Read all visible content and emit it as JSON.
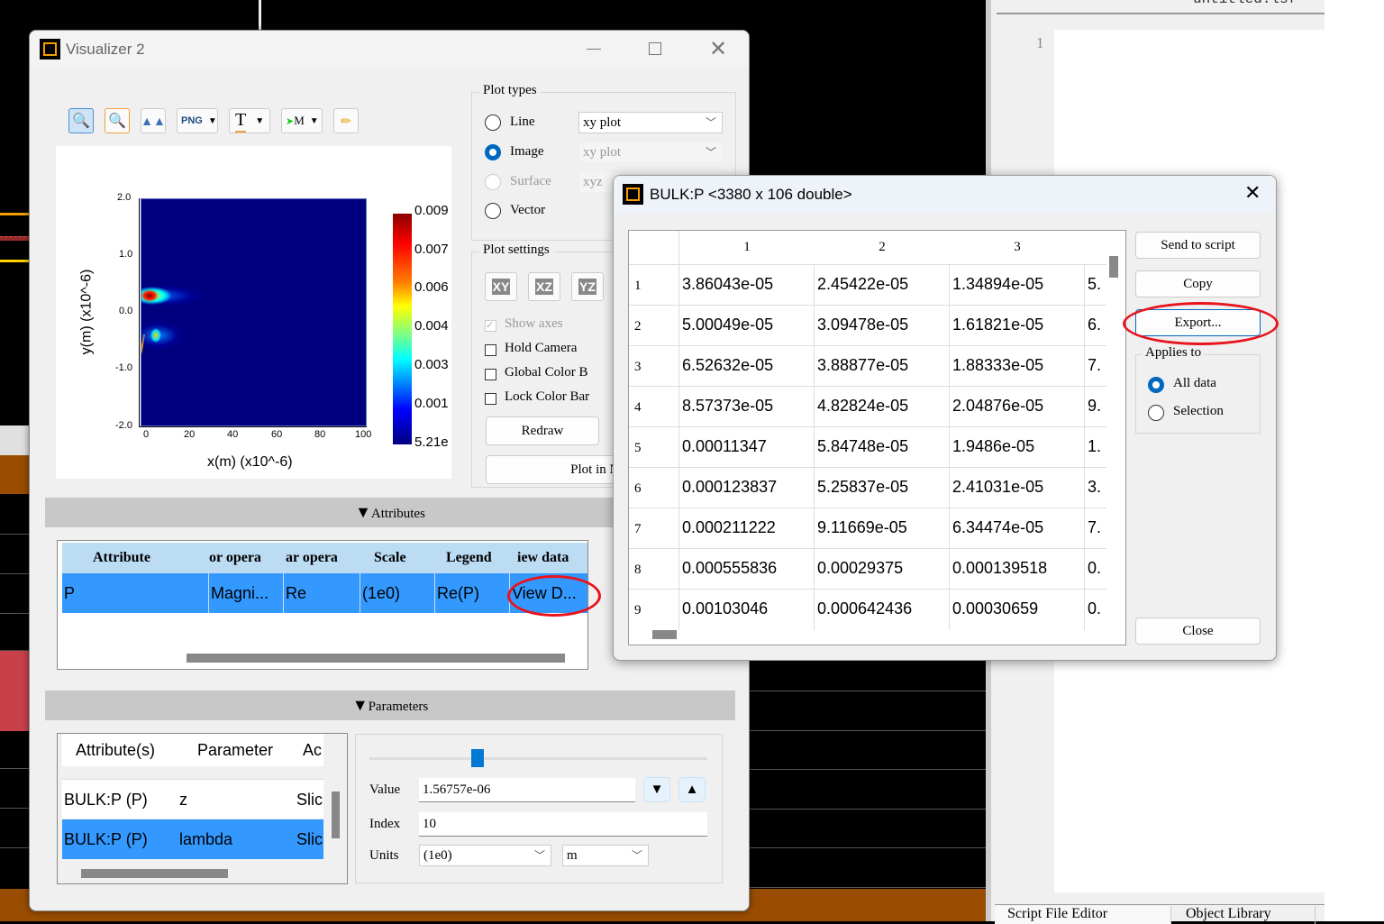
{
  "visualizer": {
    "title": "Visualizer 2",
    "toolbar": [
      {
        "icon": "zoom-reset-icon"
      },
      {
        "icon": "zoom-region-icon"
      },
      {
        "icon": "mountain-view-icon"
      },
      {
        "icon": "png-export-icon",
        "label": "PNG"
      },
      {
        "icon": "text-icon",
        "label": "T"
      },
      {
        "icon": "matlab-export-icon",
        "label": "M"
      },
      {
        "icon": "pencil-icon"
      }
    ],
    "plot": {
      "xlabel": "x(m) (x10^-6)",
      "ylabel": "y(m) (x10^-6)",
      "xticks": [
        "0",
        "20",
        "40",
        "60",
        "80",
        "100"
      ],
      "yticks": [
        "2.0",
        "1.0",
        "0.0",
        "-1.0",
        "-2.0"
      ],
      "colorbar_ticks": [
        "0.009",
        "0.007",
        "0.006",
        "0.004",
        "0.003",
        "0.001",
        "5.21e"
      ]
    },
    "plot_types": {
      "title": "Plot types",
      "options": [
        {
          "label": "Line",
          "selected": false,
          "combo": "xy plot"
        },
        {
          "label": "Image",
          "selected": true,
          "combo": "xy plot"
        },
        {
          "label": "Surface",
          "selected": false,
          "combo": "xyz"
        },
        {
          "label": "Vector",
          "selected": false
        }
      ]
    },
    "plot_settings": {
      "title": "Plot settings",
      "view_buttons": [
        "XY",
        "XZ",
        "YZ"
      ],
      "checks": [
        {
          "label": "Show axes",
          "checked": true,
          "disabled": true
        },
        {
          "label": "Hold Camera",
          "checked": false
        },
        {
          "label": "Global Color B",
          "checked": false
        },
        {
          "label": "Lock Color Bar",
          "checked": false
        }
      ],
      "redraw": "Redraw",
      "plot_new": "Plot in Ne"
    },
    "attributes": {
      "header": "Attributes",
      "columns": [
        "Attribute",
        "or opera",
        "ar opera",
        "Scale",
        "Legend",
        "iew data"
      ],
      "row": [
        "P",
        "Magni...",
        "Re",
        "(1e0)",
        "Re(P)",
        "View D..."
      ]
    },
    "parameters": {
      "header": "Parameters",
      "columns": [
        "Attribute(s)",
        "Parameter",
        "Ac"
      ],
      "rows": [
        [
          "BULK:P (P)",
          "z",
          "Slic"
        ],
        [
          "BULK:P (P)",
          "lambda",
          "Slic"
        ]
      ],
      "value_label": "Value",
      "value": "1.56757e-06",
      "index_label": "Index",
      "index": "10",
      "units_label": "Units",
      "units_scale": "(1e0)",
      "units": "m",
      "slider_fraction": 0.32
    }
  },
  "dialog": {
    "title": "BULK:P <3380 x 106 double>",
    "columns": [
      "1",
      "2",
      "3"
    ],
    "rows": [
      [
        "1",
        "3.86043e-05",
        "2.45422e-05",
        "1.34894e-05",
        "5."
      ],
      [
        "2",
        "5.00049e-05",
        "3.09478e-05",
        "1.61821e-05",
        "6."
      ],
      [
        "3",
        "6.52632e-05",
        "3.88877e-05",
        "1.88333e-05",
        "7."
      ],
      [
        "4",
        "8.57373e-05",
        "4.82824e-05",
        "2.04876e-05",
        "9."
      ],
      [
        "5",
        "0.00011347",
        "5.84748e-05",
        "1.9486e-05",
        "1."
      ],
      [
        "6",
        "0.000123837",
        "5.25837e-05",
        "2.41031e-05",
        "3."
      ],
      [
        "7",
        "0.000211222",
        "9.11669e-05",
        "6.34474e-05",
        "7."
      ],
      [
        "8",
        "0.000555836",
        "0.00029375",
        "0.000139518",
        "0."
      ],
      [
        "9",
        "0.00103046",
        "0.000642436",
        "0.00030659",
        "0."
      ]
    ],
    "send_to_script": "Send to script",
    "copy": "Copy",
    "export": "Export...",
    "applies_to": "Applies to",
    "all_data": "All data",
    "selection": "Selection",
    "close": "Close"
  },
  "editor": {
    "title": "untitled.lsf",
    "line_number": "1",
    "tabs": [
      "Script File Editor",
      "Object Library"
    ]
  },
  "colors": {
    "accent": "#0067c0",
    "selection": "#3399ff",
    "header": "#bcdcf4",
    "annotation": "#e8141e"
  }
}
